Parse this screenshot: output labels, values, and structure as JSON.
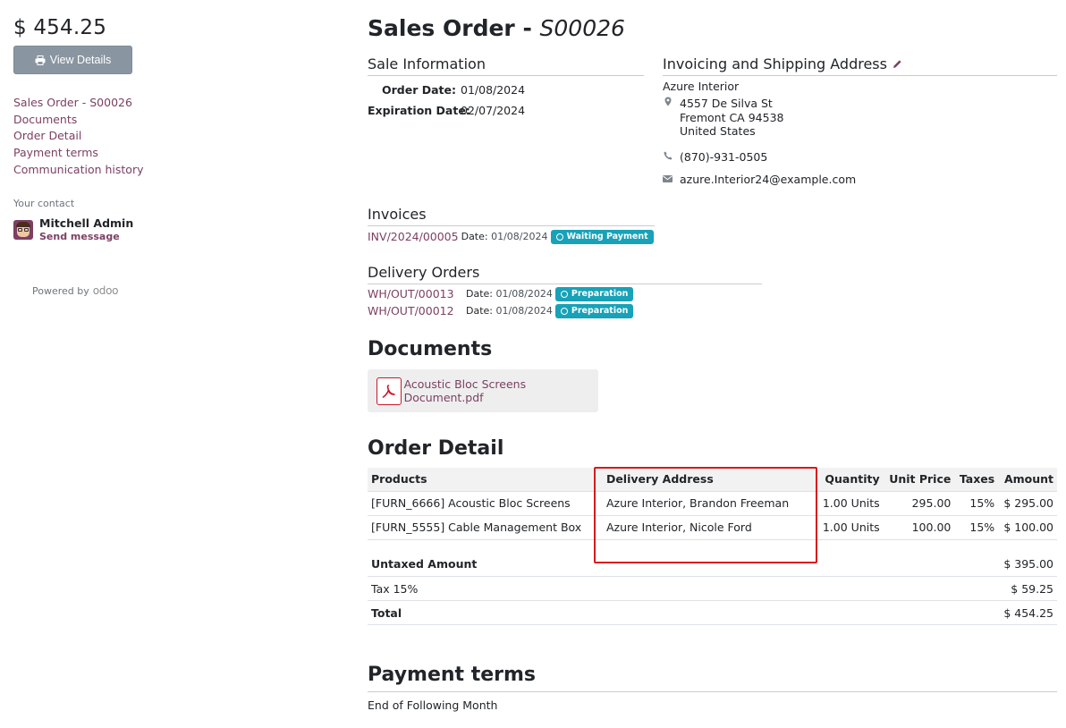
{
  "sidebar": {
    "amount_total": "$ 454.25",
    "view_details_label": "View Details",
    "toc": [
      "Sales Order - S00026",
      "Documents",
      "Order Detail",
      "Payment terms",
      "Communication history"
    ],
    "contact_heading": "Your contact",
    "contact_name": "Mitchell Admin",
    "send_message": "Send message",
    "powered_by": "Powered by",
    "odoo_logo": "odoo"
  },
  "header": {
    "title_prefix": "Sales Order - ",
    "order_ref": "S00026"
  },
  "sale_info": {
    "heading": "Sale Information",
    "order_date_label": "Order Date:",
    "order_date": "01/08/2024",
    "expiration_label": "Expiration Date:",
    "expiration_date": "02/07/2024"
  },
  "address": {
    "heading": "Invoicing and Shipping Address",
    "name": "Azure Interior",
    "street": "4557 De Silva St",
    "city": "Fremont CA 94538",
    "country": "United States",
    "phone": "(870)-931-0505",
    "email": "azure.Interior24@example.com"
  },
  "invoices": {
    "heading": "Invoices",
    "items": [
      {
        "ref": "INV/2024/00005",
        "date_label": "Date:",
        "date": "01/08/2024",
        "status": "Waiting Payment"
      }
    ]
  },
  "delivery": {
    "heading": "Delivery Orders",
    "items": [
      {
        "ref": "WH/OUT/00013",
        "date_label": "Date:",
        "date": "01/08/2024",
        "status": "Preparation"
      },
      {
        "ref": "WH/OUT/00012",
        "date_label": "Date:",
        "date": "01/08/2024",
        "status": "Preparation"
      }
    ]
  },
  "documents": {
    "heading": "Documents",
    "files": [
      {
        "name": "Acoustic Bloc Screens Document.pdf",
        "icon": "pdf-icon"
      }
    ]
  },
  "order_detail": {
    "heading": "Order Detail",
    "columns": [
      "Products",
      "Delivery Address",
      "Quantity",
      "Unit Price",
      "Taxes",
      "Amount"
    ],
    "rows": [
      [
        "[FURN_6666] Acoustic Bloc Screens",
        "Azure Interior, Brandon Freeman",
        "1.00 Units",
        "295.00",
        "15%",
        "$ 295.00"
      ],
      [
        "[FURN_5555] Cable Management Box",
        "Azure Interior, Nicole Ford",
        "1.00 Units",
        "100.00",
        "15%",
        "$ 100.00"
      ]
    ],
    "totals": {
      "untaxed_label": "Untaxed Amount",
      "untaxed": "$ 395.00",
      "tax_label": "Tax 15%",
      "tax": "$ 59.25",
      "total_label": "Total",
      "total": "$ 454.25"
    }
  },
  "payment_terms": {
    "heading": "Payment terms",
    "text": "End of Following Month"
  },
  "colors": {
    "link": "#7c4063",
    "badge": "#17a2b8",
    "button": "#8995a1",
    "highlight": "#d81a1a"
  }
}
